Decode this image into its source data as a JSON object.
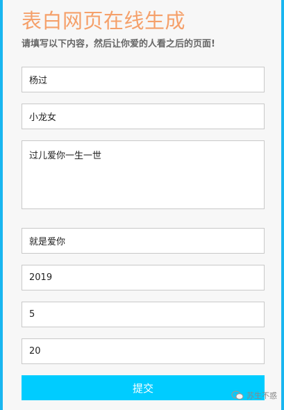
{
  "page": {
    "title": "表白网页在线生成",
    "subtitle": "请填写以下内容，然后让你爱的人看之后的页面!"
  },
  "form": {
    "field_1": "杨过",
    "field_2": "小龙女",
    "message": "过儿爱你一生一世",
    "field_4": "就是爱你",
    "year": "2019",
    "month": "5",
    "day": "20",
    "submit_label": "提交"
  },
  "watermark": {
    "text": "苏生不惑",
    "icon": "wechat-icon"
  },
  "colors": {
    "title": "#f5a06a",
    "accent": "#00ccff",
    "edge": "#1ab6f0"
  }
}
